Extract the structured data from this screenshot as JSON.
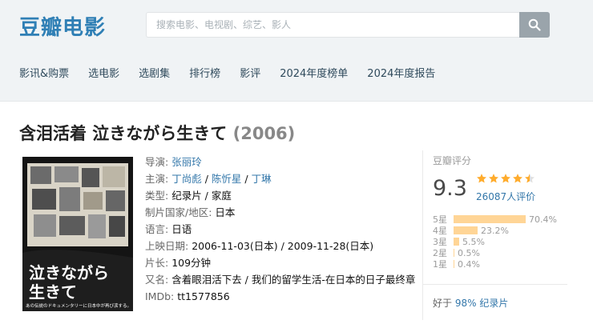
{
  "header": {
    "logo": "豆瓣电影",
    "search_placeholder": "搜索电影、电视剧、综艺、影人"
  },
  "nav": [
    "影讯&购票",
    "选电影",
    "选剧集",
    "排行榜",
    "影评",
    "2024年度榜单",
    "2024年度报告"
  ],
  "movie": {
    "title": "含泪活着 泣きながら生きて",
    "year": "(2006)",
    "poster": {
      "headline": "泣きながら\n生きて",
      "tagline": "あの伝説のドキュメンタリーに日本中が再び涙する。"
    },
    "info": {
      "director_label": "导演:",
      "director": "张丽玲",
      "cast_label": "主演:",
      "cast": [
        "丁尚彪",
        "陈忻星",
        "丁琳"
      ],
      "genre_label": "类型:",
      "genre": "纪录片 / 家庭",
      "country_label": "制片国家/地区:",
      "country": "日本",
      "language_label": "语言:",
      "language": "日语",
      "release_label": "上映日期:",
      "release": "2006-11-03(日本) / 2009-11-28(日本)",
      "runtime_label": "片长:",
      "runtime": "109分钟",
      "aka_label": "又名:",
      "aka": "含着眼泪活下去 / 我们的留学生活-在日本的日子最终章",
      "imdb_label": "IMDb:",
      "imdb": "tt1577856"
    }
  },
  "rating": {
    "label": "豆瓣评分",
    "score": "9.3",
    "stars": 4.5,
    "people": "26087人评价",
    "distribution": [
      {
        "star": "5星",
        "percent": "70.4%",
        "value": 70.4
      },
      {
        "star": "4星",
        "percent": "23.2%",
        "value": 23.2
      },
      {
        "star": "3星",
        "percent": "5.5%",
        "value": 5.5
      },
      {
        "star": "2星",
        "percent": "0.5%",
        "value": 0.5
      },
      {
        "star": "1星",
        "percent": "0.4%",
        "value": 0.4
      }
    ],
    "better_prefix": "好于",
    "better_link": "98% 纪录片"
  },
  "colors": {
    "brand": "#2f7fb5",
    "link": "#3377aa",
    "bar": "#ffd596",
    "star": "#ffac2d"
  }
}
